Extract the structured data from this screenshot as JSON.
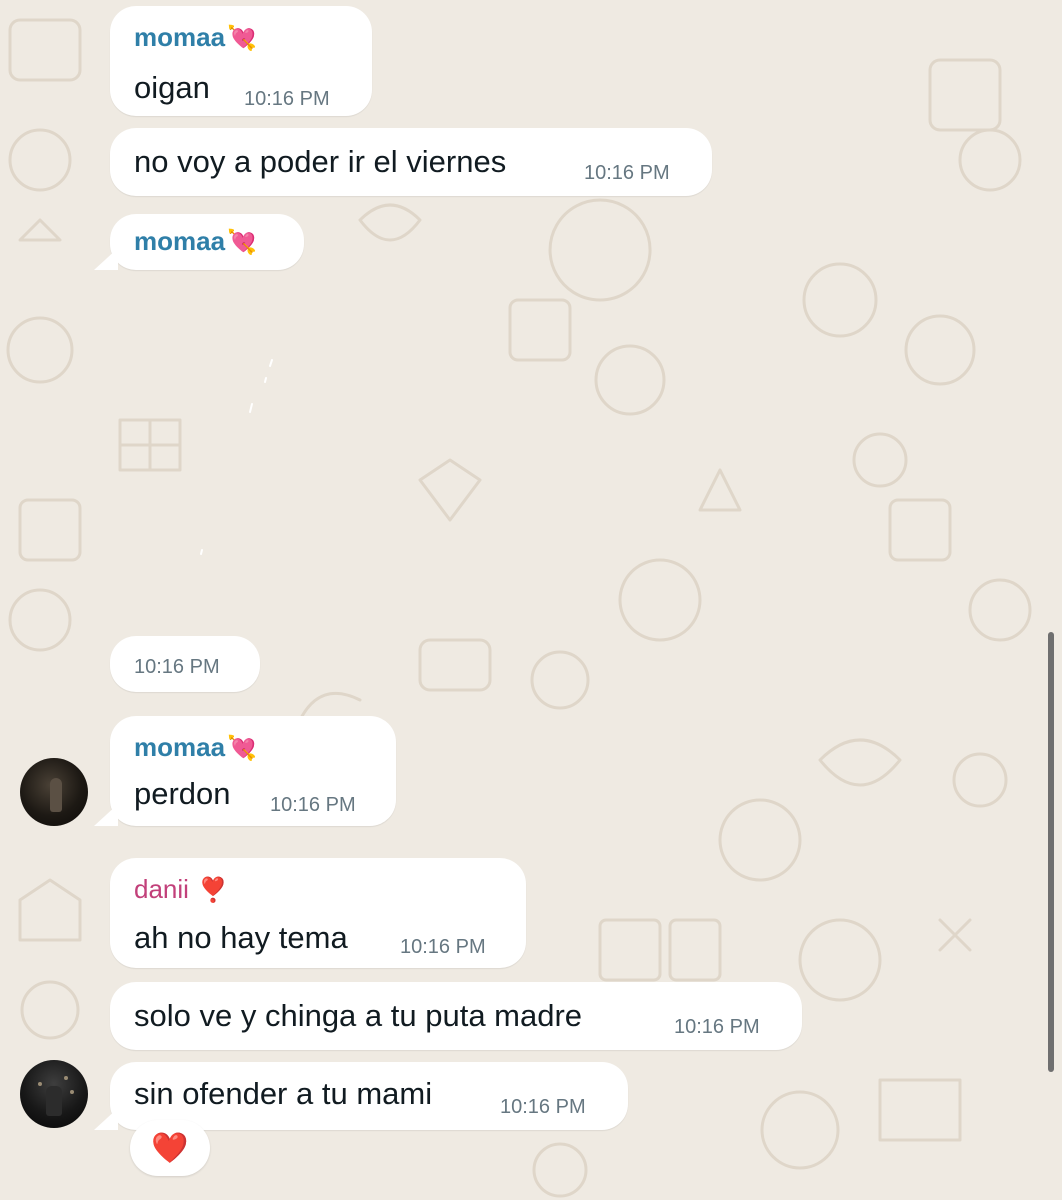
{
  "colors": {
    "background": "#efeae2",
    "bubble": "#ffffff",
    "sender_momaa": "#2f7fa8",
    "sender_danii": "#c2407a",
    "timestamp": "#667781",
    "text": "#111b21"
  },
  "messages": [
    {
      "sender": "momaa",
      "sender_emoji": "💘",
      "text": "oigan",
      "time": "10:16 PM"
    },
    {
      "text": "no voy a poder ir el viernes",
      "time": "10:16 PM"
    },
    {
      "sender": "momaa",
      "sender_emoji": "💘",
      "sticker": true,
      "time": "10:16 PM"
    },
    {
      "sender": "momaa",
      "sender_emoji": "💘",
      "text": "perdon",
      "time": "10:16 PM",
      "avatar": "momaa-avatar"
    },
    {
      "sender": "danii",
      "sender_emoji": "❣️",
      "text": "ah no hay tema",
      "time": "10:16 PM"
    },
    {
      "text": "solo ve y chinga a tu puta madre",
      "time": "10:16 PM"
    },
    {
      "text": "sin ofender a tu mami",
      "time": "10:16 PM",
      "avatar": "danii-avatar",
      "reaction": "❤️"
    }
  ]
}
